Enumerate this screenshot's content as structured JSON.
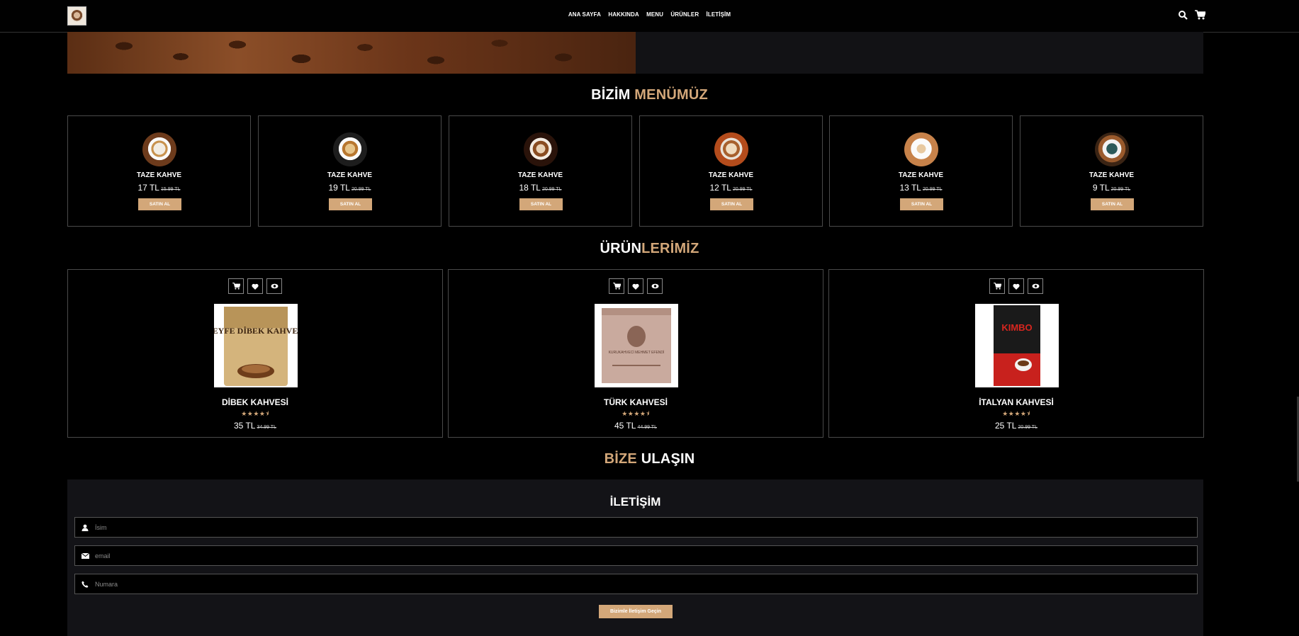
{
  "header": {
    "nav": [
      "ANA SAYFA",
      "HAKKINDA",
      "MENU",
      "ÜRÜNLER",
      "İLETİŞİM"
    ],
    "icons": [
      "search-icon",
      "cart-icon"
    ]
  },
  "menu_section": {
    "title_part1": "BİZİM",
    "title_part2": "MENÜMÜZ",
    "items": [
      {
        "name": "TAZE KAHVE",
        "price": "17 TL",
        "old_price": "15.99 TL",
        "button": "SATIN AL"
      },
      {
        "name": "TAZE KAHVE",
        "price": "19 TL",
        "old_price": "20.99 TL",
        "button": "SATIN AL"
      },
      {
        "name": "TAZE KAHVE",
        "price": "18 TL",
        "old_price": "20.99 TL",
        "button": "SATIN AL"
      },
      {
        "name": "TAZE KAHVE",
        "price": "12 TL",
        "old_price": "20.99 TL",
        "button": "SATIN AL"
      },
      {
        "name": "TAZE KAHVE",
        "price": "13 TL",
        "old_price": "20.99 TL",
        "button": "SATIN AL"
      },
      {
        "name": "TAZE KAHVE",
        "price": "9 TL",
        "old_price": "20.99 TL",
        "button": "SATIN AL"
      }
    ]
  },
  "products_section": {
    "title_part1": "ÜRÜN",
    "title_part2": "LERİMİZ",
    "items": [
      {
        "name": "DİBEK KAHVESİ",
        "rating": 4.5,
        "stars": "★★★★⯨",
        "price": "35 TL",
        "old_price": "34.99 TL",
        "package_text": "KEYFE DİBEK KAHVESİ"
      },
      {
        "name": "TÜRK KAHVESİ",
        "rating": 4.5,
        "stars": "★★★★⯨",
        "price": "45 TL",
        "old_price": "44.99 TL",
        "package_text": "KURUKAHVECİ MEHMET EFENDİ"
      },
      {
        "name": "İTALYAN KAHVESİ",
        "rating": 4.5,
        "stars": "★★★★⯨",
        "price": "25 TL",
        "old_price": "20.99 TL",
        "package_text": "KIMBO"
      }
    ],
    "action_icons": [
      "cart-icon",
      "heart-icon",
      "eye-icon"
    ]
  },
  "contact_section": {
    "title_part1": "BİZE",
    "title_part2": "ULAŞIN",
    "form_title": "İLETİŞİM",
    "fields": [
      {
        "icon": "user-icon",
        "placeholder": "İsim"
      },
      {
        "icon": "envelope-icon",
        "placeholder": "email"
      },
      {
        "icon": "phone-icon",
        "placeholder": "Numara"
      }
    ],
    "submit_label": "Bizimle İletişim Geçin"
  },
  "colors": {
    "accent": "#d3a779",
    "background": "#000000",
    "panel": "#131317",
    "border": "#4a4a4a"
  }
}
